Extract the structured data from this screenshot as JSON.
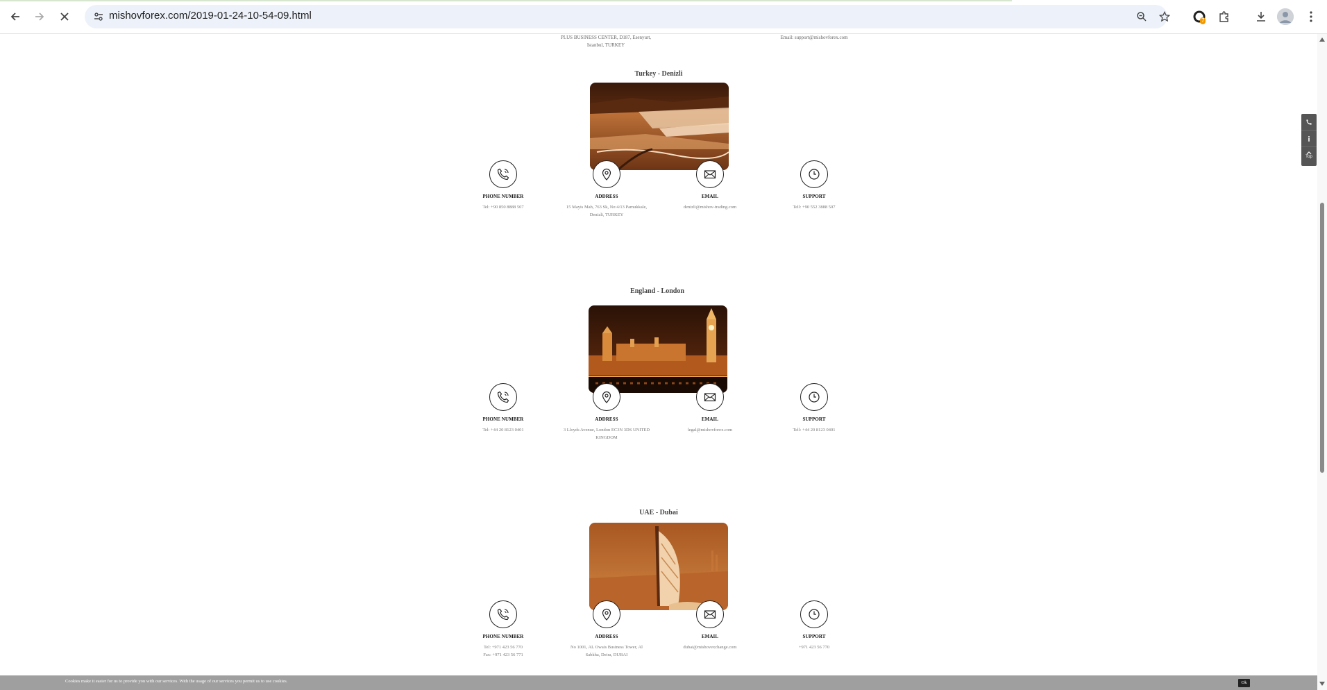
{
  "browser": {
    "url": "mishovforex.com/2019-01-24-10-54-09.html",
    "extension_badge": "7",
    "icons": {
      "back": "arrow-left-icon",
      "forward": "arrow-right-icon",
      "stop": "close-icon",
      "site_info": "tune-icon",
      "zoom": "zoom-icon",
      "bookmark": "star-icon",
      "extension": "extension-icon",
      "extensions_menu": "puzzle-icon",
      "downloads": "download-icon",
      "profile": "avatar",
      "menu": "kebab-menu-icon"
    }
  },
  "top_fragment": {
    "address_line1": "PLUS BUSINESS CENTER, D187, Esenyurt,",
    "address_line2": "Istanbul, TURKEY",
    "email": "Email: support@mishovforex.com"
  },
  "offices": [
    {
      "title": "Turkey - Denizli",
      "phone_label": "PHONE NUMBER",
      "phone_lines": [
        "Tel: +90 850 8888 507"
      ],
      "address_label": "ADDRESS",
      "address_lines": [
        "15 Mayis Mah, 763 Sk, No:4/13 Pamukkale,",
        "Denizli, TURKEY"
      ],
      "email_label": "EMAIL",
      "email_lines": [
        "denizli@mishov-trading.com"
      ],
      "support_label": "SUPPORT",
      "support_lines": [
        "Tell: +90 552 3888 507"
      ]
    },
    {
      "title": "England - London",
      "phone_label": "PHONE NUMBER",
      "phone_lines": [
        "Tel: +44 20 8123 0401"
      ],
      "address_label": "ADDRESS",
      "address_lines": [
        "3 Lloyds Avenue, London EC3N 3DS UNITED",
        "KINGDOM"
      ],
      "email_label": "EMAIL",
      "email_lines": [
        "legal@mishovforex.com"
      ],
      "support_label": "SUPPORT",
      "support_lines": [
        "Tell: +44 20 8123 0401"
      ]
    },
    {
      "title": "UAE - Dubai",
      "phone_label": "PHONE NUMBER",
      "phone_lines": [
        "Tel: +971 423 56 770",
        "Fax: +971 423 56 771"
      ],
      "address_label": "ADDRESS",
      "address_lines": [
        "No 1001, AL Owais Business Tower, Al",
        "Sabkha, Deira, DUBAI"
      ],
      "email_label": "EMAIL",
      "email_lines": [
        "dubai@mishovexchange.com"
      ],
      "support_label": "SUPPORT",
      "support_lines": [
        "+971 423 56 770"
      ]
    }
  ],
  "float_tools": {
    "top_label": "Top"
  },
  "cookie": {
    "text": "Cookies make it easier for us to provide you with our services. With the usage of our services you permit us to use cookies.",
    "ok": "Ok"
  },
  "colors": {
    "photo_tint": "#b8642a",
    "icon_stroke": "#222222",
    "cookie_bar": "#9f9f9f",
    "omnibox": "#edf2fa"
  }
}
